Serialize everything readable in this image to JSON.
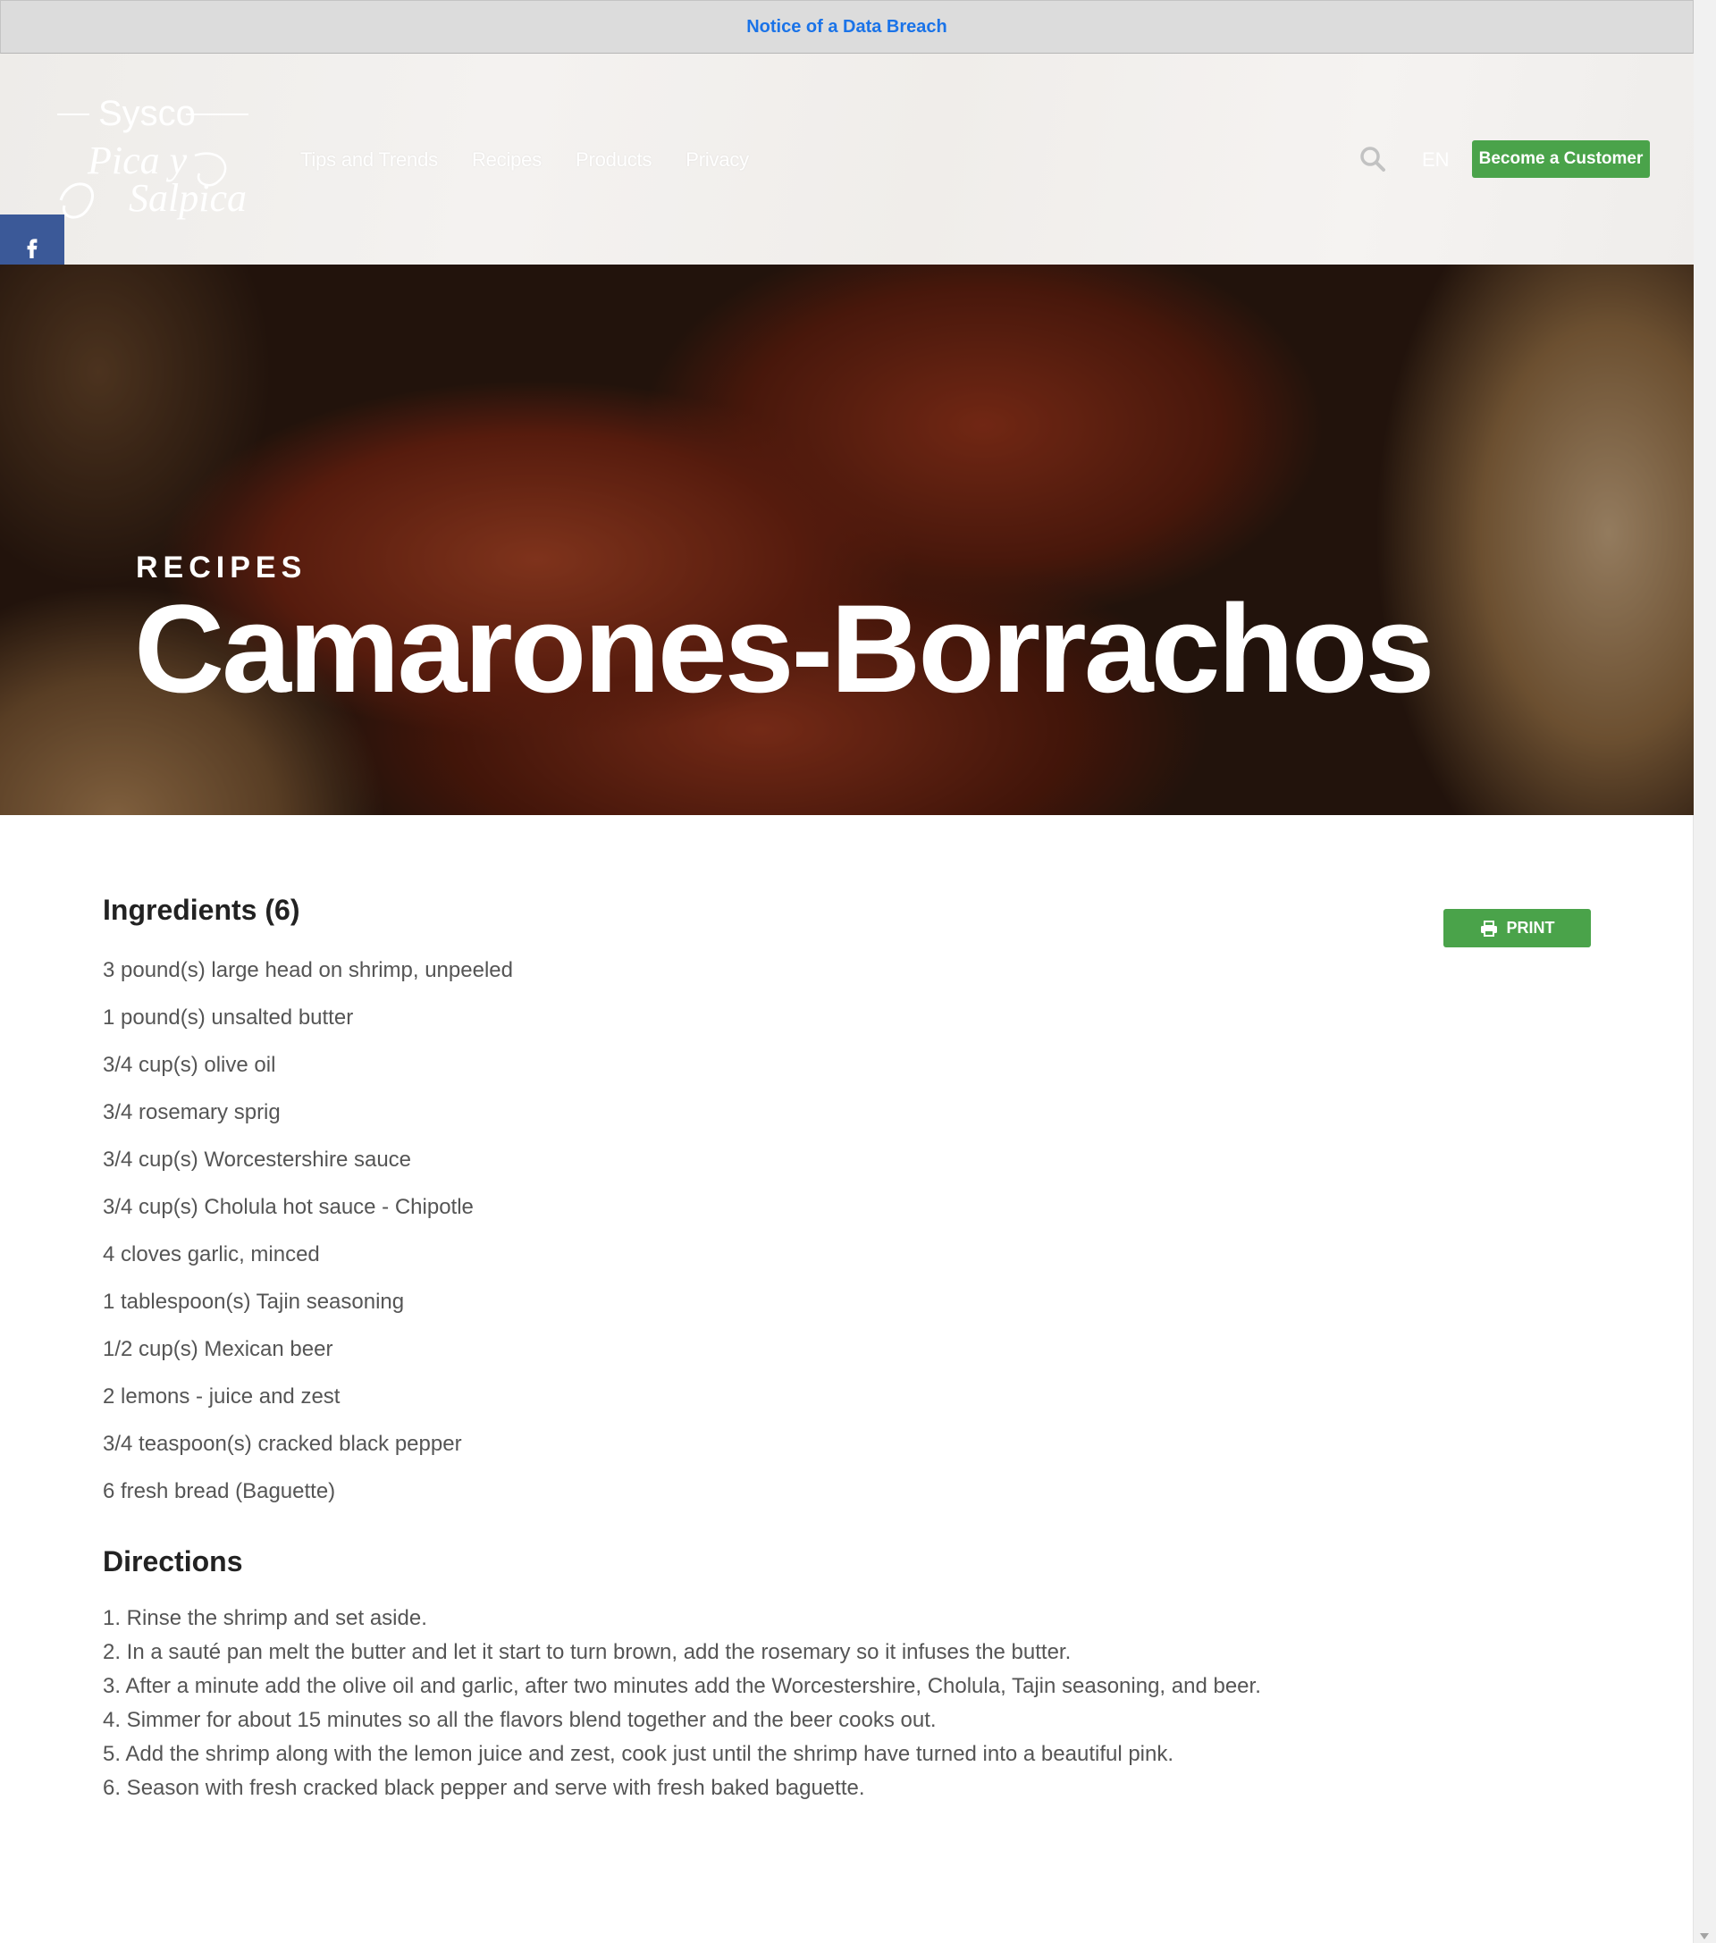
{
  "notice": {
    "text": "Notice of a Data Breach"
  },
  "header": {
    "logo_brand": "Sysco",
    "logo_line1": "Pica y",
    "logo_line2": "Salpica",
    "nav": [
      "Tips and Trends",
      "Recipes",
      "Products",
      "Privacy"
    ],
    "language": "EN",
    "cta_label": "Become a Customer"
  },
  "share_icons": [
    "facebook-icon",
    "x-icon",
    "pinterest-icon",
    "email-icon",
    "share-icon"
  ],
  "hero": {
    "kicker": "RECIPES",
    "title": "Camarones-Borrachos"
  },
  "ingredients": {
    "title": "Ingredients (6)",
    "print_label": "PRINT",
    "items": [
      "3 pound(s) large head on shrimp, unpeeled",
      "1 pound(s) unsalted butter",
      "3/4 cup(s) olive oil",
      "3/4 rosemary sprig",
      "3/4 cup(s) Worcestershire sauce",
      "3/4 cup(s) Cholula hot sauce - Chipotle",
      "4 cloves garlic, minced",
      "1 tablespoon(s) Tajin seasoning",
      "1/2 cup(s) Mexican beer",
      "2 lemons - juice and zest",
      "3/4 teaspoon(s) cracked black pepper",
      "6 fresh bread (Baguette)"
    ]
  },
  "directions": {
    "title": "Directions",
    "steps": [
      "1. Rinse the shrimp and set aside.",
      "2. In a sauté pan melt the butter and let it start to turn brown, add the rosemary so it infuses the butter.",
      "3. After a minute add the olive oil and garlic, after two minutes add the Worcestershire, Cholula, Tajin seasoning, and beer.",
      "4. Simmer for about 15 minutes so all the flavors blend together and the beer cooks out.",
      "5. Add the shrimp along with the lemon juice and zest, cook just until the shrimp have turned into a beautiful pink.",
      "6. Season with fresh cracked black pepper and serve with fresh baked baguette."
    ]
  },
  "colors": {
    "accent_green": "#4aa34a",
    "link_blue": "#1a73e8",
    "facebook": "#3b5998",
    "pinterest": "#cb2027",
    "share_green": "#66bd2b"
  }
}
